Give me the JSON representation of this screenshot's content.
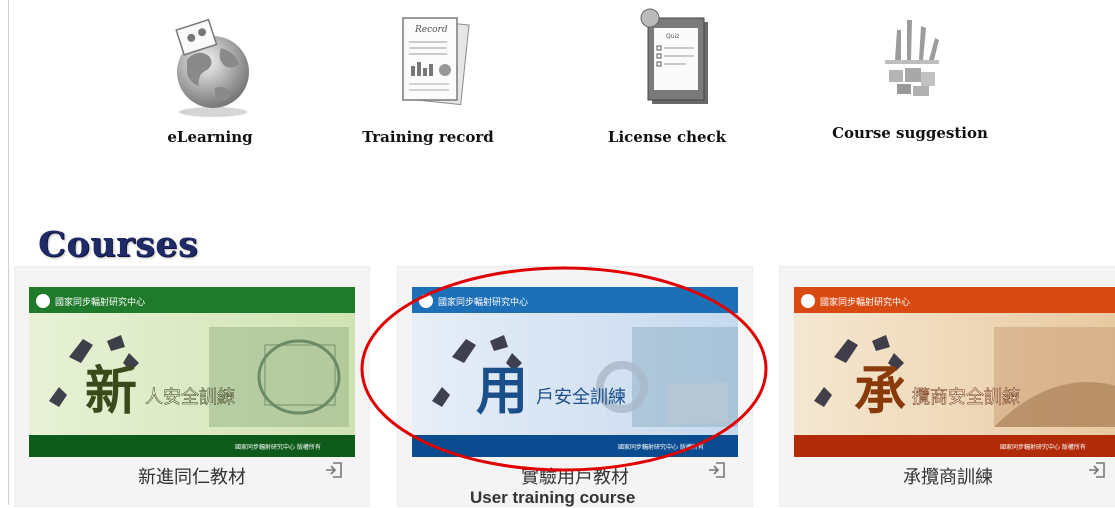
{
  "quick_links": [
    {
      "label": "eLearning",
      "icon": "globe-icon"
    },
    {
      "label": "Training record",
      "icon": "record-document-icon"
    },
    {
      "label": "License check",
      "icon": "checklist-clipboard-icon"
    },
    {
      "label": "Course suggestion",
      "icon": "raised-hands-icon"
    }
  ],
  "section": {
    "title": "Courses"
  },
  "courses": [
    {
      "title": "新進同仁教材",
      "banner_big_char": "新",
      "banner_text": "人安全訓練",
      "banner_org": "國家同步輻射研究中心",
      "banner_footer": "國家同步輻射研究中心 版權所有",
      "theme": "green",
      "colors": {
        "top": "#1f7a2b",
        "bottom": "#0d5a1a",
        "accent": "#e9f2d8"
      }
    },
    {
      "title": "實驗用戶教材",
      "banner_big_char": "用",
      "banner_text": "戶安全訓練",
      "banner_org": "國家同步輻射研究中心",
      "banner_footer": "國家同步輻射研究中心 版權所有",
      "theme": "blue",
      "colors": {
        "top": "#1d6fb8",
        "bottom": "#0b4b8f",
        "accent": "#e5eef8"
      }
    },
    {
      "title": "承攬商訓練",
      "banner_big_char": "承",
      "banner_text": "攬商安全訓練",
      "banner_org": "國家同步輻射研究中心",
      "banner_footer": "國家同步輻射研究中心 版權所有",
      "theme": "orange",
      "colors": {
        "top": "#d94a12",
        "bottom": "#b22b08",
        "accent": "#f6e8d4"
      }
    }
  ],
  "caption": "User training course",
  "highlight_color": "#e00000"
}
